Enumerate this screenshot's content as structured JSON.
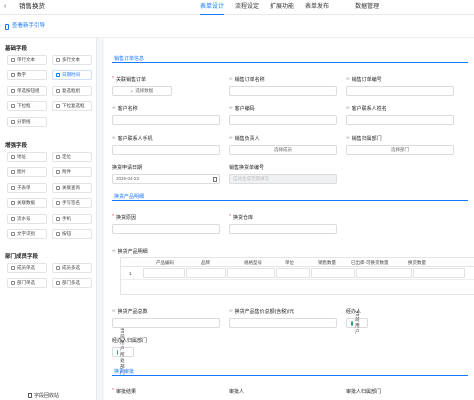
{
  "app": {
    "title": "销售换货"
  },
  "tabs": [
    {
      "label": "表单设计",
      "active": true
    },
    {
      "label": "流程设定",
      "active": false
    },
    {
      "label": "扩展功能",
      "active": false
    },
    {
      "label": "表单发布",
      "active": false
    },
    {
      "label": "数据管理",
      "active": false
    }
  ],
  "subbar": {
    "phone_link": "查看新手引导"
  },
  "left": {
    "groups": [
      {
        "title": "基础字段",
        "items": [
          "单行文本",
          "多行文本",
          "数字",
          "日期时间",
          "单选按钮组",
          "复选框组",
          "下拉框",
          "下拉复选框",
          "分割线"
        ]
      },
      {
        "title": "增强字段",
        "items": [
          "地址",
          "定位",
          "图片",
          "附件",
          "子表单",
          "关联查询",
          "关联数据",
          "手写签名",
          "流水号",
          "手机",
          "文字识别",
          "按钮"
        ]
      },
      {
        "title": "部门成员字段",
        "items": [
          "成员单选",
          "成员多选",
          "部门单选",
          "部门多选"
        ]
      }
    ],
    "recycle": "字段回收站"
  },
  "form": {
    "section_order": "销售订单信息",
    "section_product": "换货产品明细",
    "section_audit": "换货审批",
    "fields": {
      "order_link": {
        "label": "关联销售订单",
        "required": true,
        "button": "选择数据"
      },
      "order_name": {
        "label": "销售订单名称"
      },
      "order_no": {
        "label": "销售订单编号"
      },
      "customer_name": {
        "label": "客户名称"
      },
      "customer_code": {
        "label": "客户编码"
      },
      "contact_name": {
        "label": "客户联系人姓名"
      },
      "contact_phone": {
        "label": "客户联系人手机"
      },
      "sales_owner": {
        "label": "销售负责人",
        "placeholder": "选择成员"
      },
      "sales_dept": {
        "label": "销售归属部门",
        "placeholder": "选择部门"
      },
      "apply_date": {
        "label": "换货申请日期",
        "value": "2025-04-23"
      },
      "exchange_no": {
        "label": "销售换货单编号",
        "placeholder": "自动生成无需填写"
      },
      "reason": {
        "label": "换货原因",
        "required": true
      },
      "warehouse": {
        "label": "换货仓库",
        "required": true
      },
      "product_detail": {
        "label": "换货产品明细"
      },
      "total_qty": {
        "label": "换货产品总数"
      },
      "total_price": {
        "label": "换货产品售价总额(含税)/元"
      },
      "handler": {
        "label": "经办人",
        "value": "当前用户"
      },
      "handler_dept": {
        "label": "经办人归属部门",
        "value": "当前用户所处部门"
      },
      "audit_result": {
        "label": "审批结果",
        "required": true
      },
      "auditor": {
        "label": "审批人"
      },
      "auditor_dept": {
        "label": "审批人归属部门"
      }
    },
    "table": {
      "columns": [
        "产品编码",
        "品牌",
        "规格型号",
        "单位",
        "销售数量",
        "已出库-可换货数量",
        "换货数量"
      ],
      "row_number": "1"
    }
  }
}
